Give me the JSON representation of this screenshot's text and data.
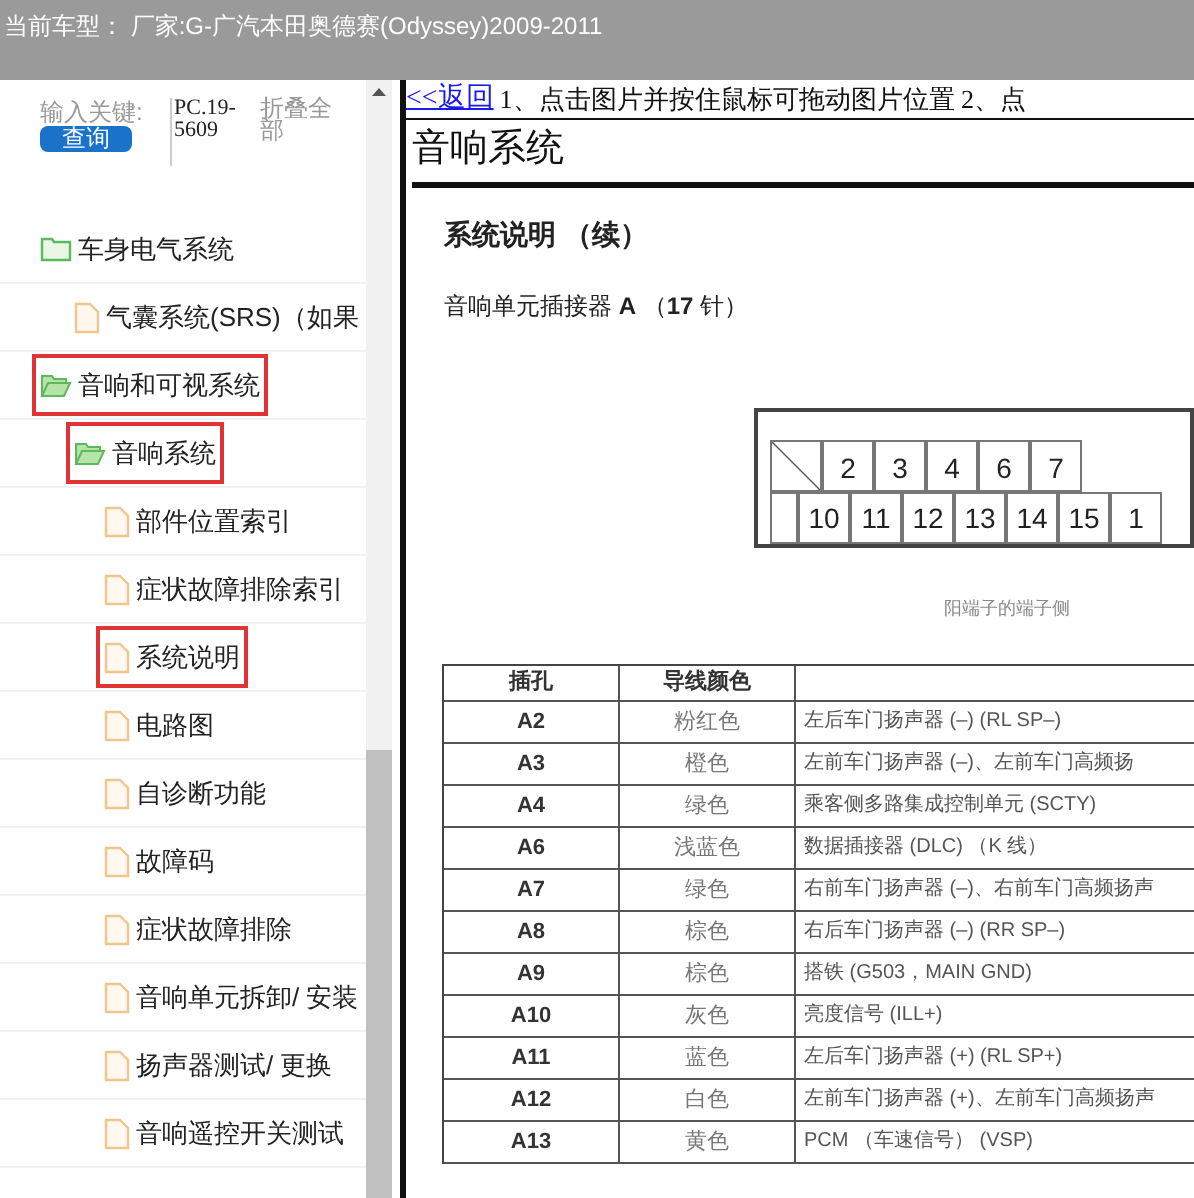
{
  "header": {
    "title": "当前车型： 厂家:G-广汽本田奥德赛(Odyssey)2009-2011"
  },
  "sidebar": {
    "search_label": "输入关键:",
    "search_button": "查询",
    "code": "PC.19-5609",
    "collapse_link": "折叠全部",
    "tree": [
      {
        "label": "车身电气系统",
        "kind": "folder",
        "expanded": false,
        "highlighted": false,
        "children": [
          {
            "label": "气囊系统(SRS)（如果",
            "kind": "page",
            "highlighted": false
          }
        ]
      },
      {
        "label": "音响和可视系统",
        "kind": "folder",
        "expanded": true,
        "highlighted": true,
        "children": [
          {
            "label": "音响系统",
            "kind": "folder",
            "expanded": true,
            "highlighted": true,
            "children": [
              {
                "label": "部件位置索引",
                "kind": "page",
                "highlighted": false
              },
              {
                "label": "症状故障排除索引",
                "kind": "page",
                "highlighted": false
              },
              {
                "label": "系统说明",
                "kind": "page",
                "highlighted": true
              },
              {
                "label": "电路图",
                "kind": "page",
                "highlighted": false
              },
              {
                "label": "自诊断功能",
                "kind": "page",
                "highlighted": false
              },
              {
                "label": "故障码",
                "kind": "page",
                "highlighted": false
              },
              {
                "label": "症状故障排除",
                "kind": "page",
                "highlighted": false
              },
              {
                "label": "音响单元拆卸/ 安装",
                "kind": "page",
                "highlighted": false
              },
              {
                "label": "扬声器测试/ 更换",
                "kind": "page",
                "highlighted": false
              },
              {
                "label": "音响遥控开关测试",
                "kind": "page",
                "highlighted": false
              }
            ]
          }
        ]
      }
    ]
  },
  "content": {
    "back_link": "<<返回",
    "instructions": "1、点击图片并按住鼠标可拖动图片位置 2、点",
    "document": {
      "title": "音响系统",
      "subtitle": "系统说明 （续）",
      "connector_heading": "音响单元插接器 **A** （**17** 针）",
      "connector": {
        "top_pins": [
          "2",
          "3",
          "4",
          "6",
          "7"
        ],
        "bottom_pins": [
          "10",
          "11",
          "12",
          "13",
          "14",
          "15",
          "1"
        ],
        "caption": "阳端子的端子侧"
      },
      "table": {
        "columns": [
          "插孔",
          "导线颜色"
        ],
        "rows": [
          [
            "A2",
            "粉红色",
            "左后车门扬声器 (–) (RL SP–)"
          ],
          [
            "A3",
            "橙色",
            "左前车门扬声器 (–)、左前车门高频扬"
          ],
          [
            "A4",
            "绿色",
            "乘客侧多路集成控制单元 (SCTY)"
          ],
          [
            "A6",
            "浅蓝色",
            "数据插接器 (DLC) （K 线）"
          ],
          [
            "A7",
            "绿色",
            "右前车门扬声器 (–)、右前车门高频扬声"
          ],
          [
            "A8",
            "棕色",
            "右后车门扬声器 (–) (RR SP–)"
          ],
          [
            "A9",
            "棕色",
            "搭铁 (G503，MAIN GND)"
          ],
          [
            "A10",
            "灰色",
            "亮度信号 (ILL+)"
          ],
          [
            "A11",
            "蓝色",
            "左后车门扬声器 (+) (RL SP+)"
          ],
          [
            "A12",
            "白色",
            "左前车门扬声器 (+)、左前车门高频扬声"
          ],
          [
            "A13",
            "黄色",
            "PCM （车速信号） (VSP)"
          ]
        ]
      }
    }
  }
}
